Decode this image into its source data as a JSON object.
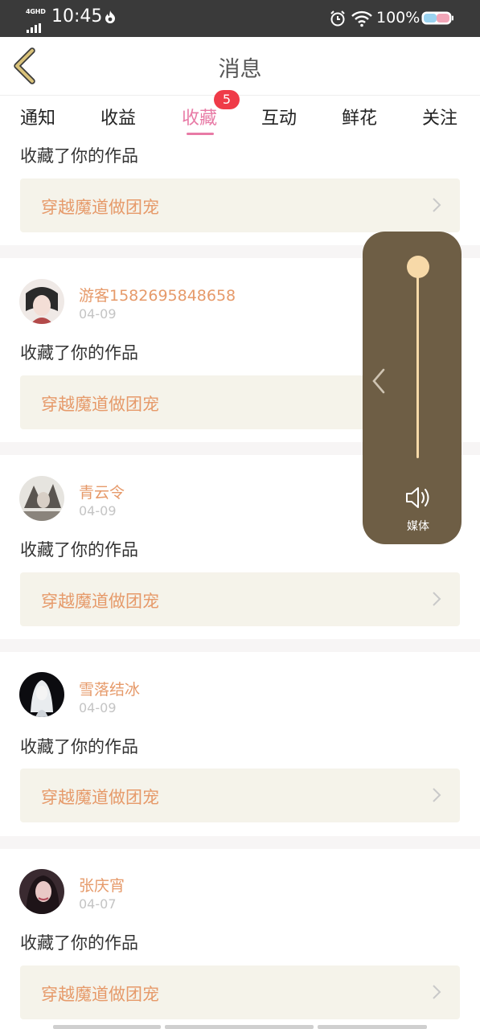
{
  "status_bar": {
    "network": "4GHD",
    "time": "10:45",
    "battery_text": "100%",
    "icons": [
      "signal-icon",
      "flame-icon",
      "alarm-icon",
      "wifi-icon",
      "battery-icon"
    ]
  },
  "header": {
    "title": "消息",
    "back_icon": "back-chevron-icon"
  },
  "tabs": {
    "items": [
      {
        "label": "通知"
      },
      {
        "label": "收益"
      },
      {
        "label": "收藏"
      },
      {
        "label": "互动"
      },
      {
        "label": "鲜花"
      },
      {
        "label": "关注"
      }
    ],
    "active_index": 2,
    "badge": "5"
  },
  "feed": {
    "partial_item": {
      "action": "收藏了你的作品",
      "work_title": "穿越魔道做团宠"
    },
    "items": [
      {
        "username": "游客1582695848658",
        "date": "04-09",
        "action": "收藏了你的作品",
        "work_title": "穿越魔道做团宠"
      },
      {
        "username": "青云令",
        "date": "04-09",
        "action": "收藏了你的作品",
        "work_title": "穿越魔道做团宠"
      },
      {
        "username": "雪落结冰",
        "date": "04-09",
        "action": "收藏了你的作品",
        "work_title": "穿越魔道做团宠"
      },
      {
        "username": "张庆宵",
        "date": "04-07",
        "action": "收藏了你的作品",
        "work_title": "穿越魔道做团宠"
      }
    ]
  },
  "volume_panel": {
    "label": "媒体",
    "level": 1.0
  },
  "colors": {
    "accent_pink": "#e87ba6",
    "username_orange": "#e69a6a",
    "badge_red": "#ef3b48",
    "panel_brown": "#6e5e45",
    "slider_cream": "#f7d9a8",
    "card_bg": "#f5f3ea",
    "back_gold": "#d9c27a"
  }
}
